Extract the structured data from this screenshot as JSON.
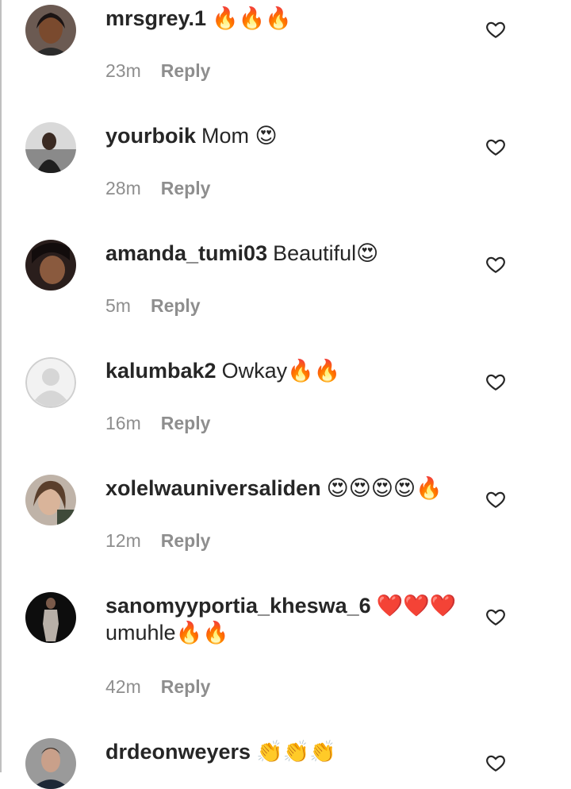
{
  "comments": [
    {
      "username": "mrsgrey.1",
      "text": "🔥🔥🔥",
      "text_line2": "",
      "time": "23m",
      "reply": "Reply"
    },
    {
      "username": "yourboik",
      "text": "Mom 😍",
      "text_line2": "",
      "time": "28m",
      "reply": "Reply"
    },
    {
      "username": "amanda_tumi03",
      "text": "Beautiful😍",
      "text_line2": "",
      "time": "5m",
      "reply": "Reply"
    },
    {
      "username": "kalumbak2",
      "text": "Owkay🔥🔥",
      "text_line2": "",
      "time": "16m",
      "reply": "Reply"
    },
    {
      "username": "xolelwauniversaliden",
      "text": "😍😍😍😍🔥",
      "text_line2": "",
      "time": "12m",
      "reply": "Reply"
    },
    {
      "username": "sanomyyportia_kheswa_6",
      "text": "❤️❤️❤️",
      "text_line2": "umuhle🔥🔥",
      "time": "42m",
      "reply": "Reply"
    },
    {
      "username": "drdeonweyers",
      "text": "👏👏👏",
      "text_line2": "",
      "time": "",
      "reply": ""
    }
  ],
  "icons": {
    "like": "heart-outline-icon",
    "default_avatar": "default-avatar-icon"
  },
  "colors": {
    "username": "#262626",
    "meta": "#8e8e8e",
    "divider": "#bfbfbf"
  }
}
